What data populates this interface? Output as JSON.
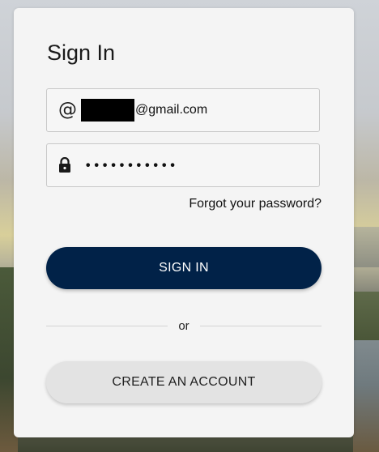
{
  "card": {
    "title": "Sign In"
  },
  "email_field": {
    "icon": "at-icon",
    "value_suffix": "@gmail.com"
  },
  "password_field": {
    "icon": "lock-icon",
    "masked_value": "•••••••••••"
  },
  "forgot_link": "Forgot your password?",
  "signin_button": "SIGN IN",
  "divider_text": "or",
  "create_button": "CREATE AN ACCOUNT",
  "colors": {
    "primary": "#012248",
    "secondary_button": "#e3e3e3",
    "card_background": "#f4f4f4"
  }
}
